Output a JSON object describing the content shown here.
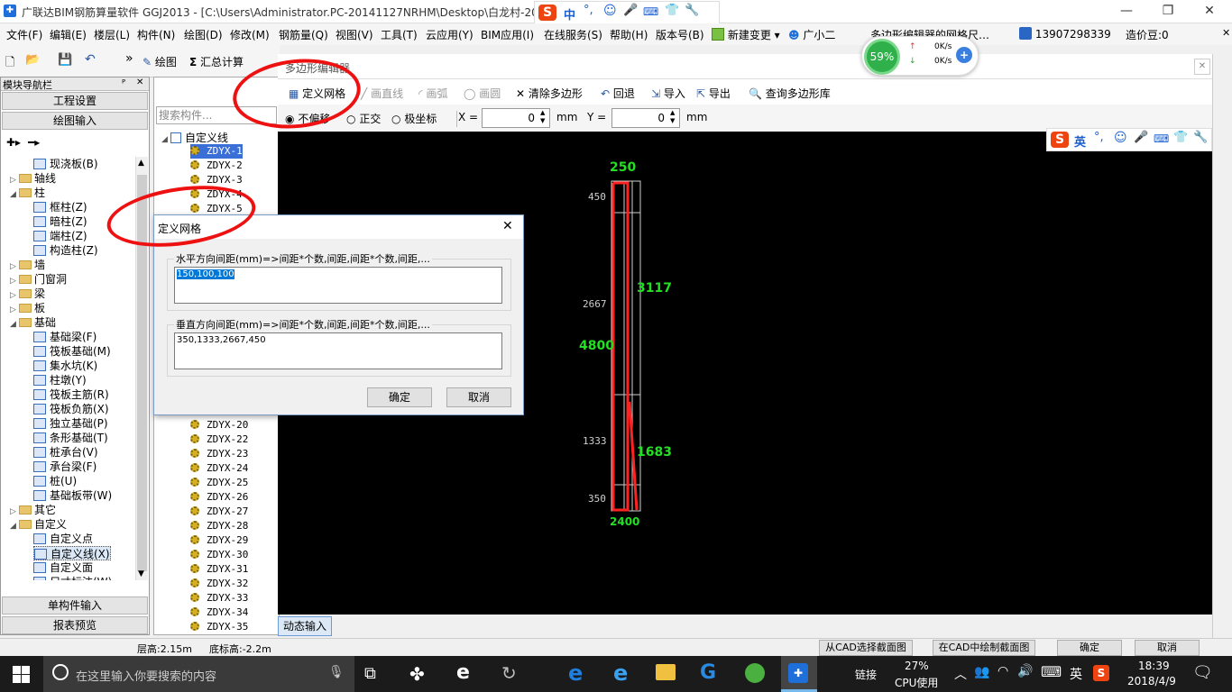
{
  "window": {
    "title": "广联达BIM钢筋算量软件 GGJ2013 - [C:\\Users\\Administrator.PC-20141127NRHM\\Desktop\\白龙村-20",
    "minimize": "—",
    "restore": "❐",
    "close": "✕"
  },
  "menu": {
    "items": [
      "文件(F)",
      "编辑(E)",
      "楼层(L)",
      "构件(N)",
      "绘图(D)",
      "修改(M)",
      "钢筋量(Q)",
      "视图(V)",
      "工具(T)",
      "云应用(Y)",
      "BIM应用(I)",
      "在线服务(S)",
      "帮助(H)",
      "版本号(B)",
      "新建变更 ▾",
      "广小二"
    ],
    "notice": "多边形编辑器的网格尺…",
    "account": "13907298339",
    "points": "造价豆:0"
  },
  "toolbar": {
    "draw": "绘图",
    "sum": "汇总计算",
    "new": "新建",
    "delete": "删除",
    "search_placeholder": "搜索构件..."
  },
  "netmeter": {
    "percent": "59%",
    "up": "0K/s",
    "down": "0K/s"
  },
  "nav": {
    "header": "模块导航栏",
    "pin": "ᴾ",
    "close": "✕",
    "project_settings": "工程设置",
    "drawing_input": "绘图输入",
    "single_input": "单构件输入",
    "report": "报表预览",
    "tree": [
      {
        "label": "现浇板(B)",
        "level": 2,
        "type": "leaf"
      },
      {
        "label": "轴线",
        "level": 1,
        "type": "folder",
        "tw": "▷"
      },
      {
        "label": "柱",
        "level": 1,
        "type": "folder",
        "tw": "◢"
      },
      {
        "label": "框柱(Z)",
        "level": 2,
        "type": "leaf"
      },
      {
        "label": "暗柱(Z)",
        "level": 2,
        "type": "leaf"
      },
      {
        "label": "端柱(Z)",
        "level": 2,
        "type": "leaf"
      },
      {
        "label": "构造柱(Z)",
        "level": 2,
        "type": "leaf"
      },
      {
        "label": "墙",
        "level": 1,
        "type": "folder",
        "tw": "▷"
      },
      {
        "label": "门窗洞",
        "level": 1,
        "type": "folder",
        "tw": "▷"
      },
      {
        "label": "梁",
        "level": 1,
        "type": "folder",
        "tw": "▷"
      },
      {
        "label": "板",
        "level": 1,
        "type": "folder",
        "tw": "▷"
      },
      {
        "label": "基础",
        "level": 1,
        "type": "folder",
        "tw": "◢"
      },
      {
        "label": "基础梁(F)",
        "level": 2,
        "type": "leaf"
      },
      {
        "label": "筏板基础(M)",
        "level": 2,
        "type": "leaf"
      },
      {
        "label": "集水坑(K)",
        "level": 2,
        "type": "leaf"
      },
      {
        "label": "柱墩(Y)",
        "level": 2,
        "type": "leaf"
      },
      {
        "label": "筏板主筋(R)",
        "level": 2,
        "type": "leaf"
      },
      {
        "label": "筏板负筋(X)",
        "level": 2,
        "type": "leaf"
      },
      {
        "label": "独立基础(P)",
        "level": 2,
        "type": "leaf"
      },
      {
        "label": "条形基础(T)",
        "level": 2,
        "type": "leaf"
      },
      {
        "label": "桩承台(V)",
        "level": 2,
        "type": "leaf"
      },
      {
        "label": "承台梁(F)",
        "level": 2,
        "type": "leaf"
      },
      {
        "label": "桩(U)",
        "level": 2,
        "type": "leaf"
      },
      {
        "label": "基础板带(W)",
        "level": 2,
        "type": "leaf"
      },
      {
        "label": "其它",
        "level": 1,
        "type": "folder",
        "tw": "▷"
      },
      {
        "label": "自定义",
        "level": 1,
        "type": "folder",
        "tw": "◢"
      },
      {
        "label": "自定义点",
        "level": 2,
        "type": "leaf"
      },
      {
        "label": "自定义线(X)",
        "level": 2,
        "type": "leaf",
        "selected": true
      },
      {
        "label": "自定义面",
        "level": 2,
        "type": "leaf"
      },
      {
        "label": "尺寸标注(W)",
        "level": 2,
        "type": "leaf"
      }
    ]
  },
  "complist": {
    "root": "自定义线",
    "items_top": [
      "ZDYX-1",
      "ZDYX-2",
      "ZDYX-3",
      "ZDYX-4",
      "ZDYX-5"
    ],
    "items_bottom": [
      "ZDYX-20",
      "ZDYX-22",
      "ZDYX-23",
      "ZDYX-24",
      "ZDYX-25",
      "ZDYX-26",
      "ZDYX-27",
      "ZDYX-28",
      "ZDYX-29",
      "ZDYX-30",
      "ZDYX-31",
      "ZDYX-32",
      "ZDYX-33",
      "ZDYX-34",
      "ZDYX-35"
    ]
  },
  "poly_editor": {
    "title": "多边形编辑器",
    "tools": [
      "定义网格",
      "画直线",
      "画弧",
      "画圆",
      "清除多边形",
      "回退",
      "导入",
      "导出",
      "查询多边形库"
    ],
    "snap_options": [
      "不偏移",
      "正交",
      "极坐标"
    ],
    "x_label": "X =",
    "x_value": "0",
    "y_label": "Y =",
    "y_value": "0",
    "unit": "mm",
    "dynamic_input": "动态输入"
  },
  "canvas_labels": {
    "top_width": "250",
    "total_height": "4800",
    "seg_1": "3117",
    "seg_2": "1683",
    "grid_450": "450",
    "grid_2667": "2667",
    "grid_1333": "1333",
    "grid_350": "350",
    "bottom": "2400"
  },
  "dialog": {
    "title": "定义网格",
    "close": "✕",
    "h_label": "水平方向间距(mm)=>间距*个数,间距,间距*个数,间距,...",
    "h_value": "150,100,100",
    "v_label": "垂直方向间距(mm)=>间距*个数,间距,间距*个数,间距,...",
    "v_value": "350,1333,2667,450",
    "ok": "确定",
    "cancel": "取消"
  },
  "sogou": {
    "mode_cn": "中",
    "mode_en": "英"
  },
  "status": {
    "floor_height": "层高:2.15m",
    "bottom_elev": "底标高:-2.2m",
    "from_cad": "从CAD选择截面图",
    "draw_in_cad": "在CAD中绘制截面图",
    "ok": "确定",
    "cancel": "取消"
  },
  "taskbar": {
    "search_placeholder": "在这里输入你要搜索的内容",
    "link": "链接",
    "cpu_pct": "27%",
    "cpu_label": "CPU使用",
    "ime": "英",
    "time": "18:39",
    "date": "2018/4/9"
  },
  "colors": {
    "annotation_red": "#ee1111",
    "dim_green": "#22e022",
    "canvas_bg": "#000000"
  }
}
